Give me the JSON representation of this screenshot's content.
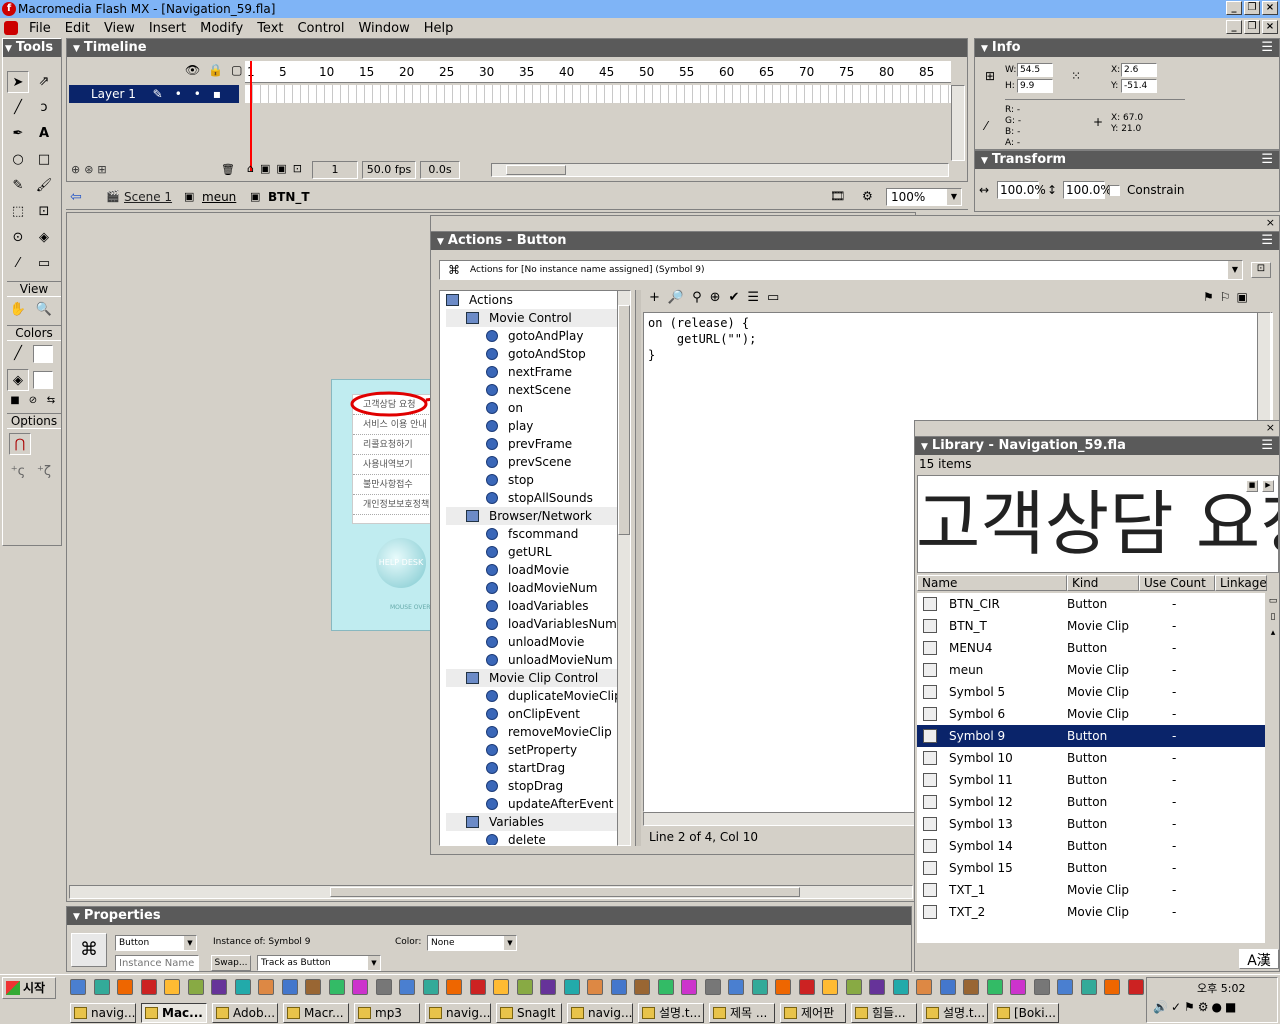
{
  "window": {
    "title": "Macromedia Flash MX - [Navigation_59.fla]",
    "app_icon": "flash-icon"
  },
  "menu": [
    "File",
    "Edit",
    "View",
    "Insert",
    "Modify",
    "Text",
    "Control",
    "Window",
    "Help"
  ],
  "tools": {
    "title": "Tools",
    "view_label": "View",
    "colors_label": "Colors",
    "options_label": "Options"
  },
  "timeline": {
    "title": "Timeline",
    "layer_name": "Layer 1",
    "frame_numbers": [
      "1",
      "5",
      "10",
      "15",
      "20",
      "25",
      "30",
      "35",
      "40",
      "45",
      "50",
      "55",
      "60",
      "65",
      "70",
      "75",
      "80",
      "85"
    ],
    "current_frame": "1",
    "fps": "50.0 fps",
    "time": "0.0s"
  },
  "editbar": {
    "scene": "Scene 1",
    "crumb1": "meun",
    "crumb2": "BTN_T",
    "zoom": "100%"
  },
  "stage_menu": {
    "items": [
      "고객상담 요청",
      "서비스 이용 안내",
      "리콜요청하기",
      "사용내역보기",
      "불만사항접수",
      "개인정보보호정책"
    ],
    "help_desk": "HELP DESK",
    "mouse_over": "MOUSE OVER"
  },
  "info": {
    "title": "Info",
    "w": "54.5",
    "h": "9.9",
    "x": "2.6",
    "y": "-51.4",
    "r": "R: -",
    "g": "G: -",
    "b": "B: -",
    "a": "A: -",
    "cx": "X: 67.0",
    "cy": "Y: 21.0",
    "w_label": "W:",
    "h_label": "H:",
    "x_label": "X:",
    "y_label": "Y:"
  },
  "transform": {
    "title": "Transform",
    "w": "100.0%",
    "h": "100.0%",
    "constrain": "Constrain"
  },
  "actions": {
    "title": "Actions - Button",
    "target": "Actions for [No instance name assigned]  (Symbol 9)",
    "tree": [
      {
        "label": "Actions",
        "type": "book",
        "level": 0
      },
      {
        "label": "Movie Control",
        "type": "book",
        "level": 1
      },
      {
        "label": "gotoAndPlay",
        "type": "item",
        "level": 2
      },
      {
        "label": "gotoAndStop",
        "type": "item",
        "level": 2
      },
      {
        "label": "nextFrame",
        "type": "item",
        "level": 2
      },
      {
        "label": "nextScene",
        "type": "item",
        "level": 2
      },
      {
        "label": "on",
        "type": "item",
        "level": 2
      },
      {
        "label": "play",
        "type": "item",
        "level": 2
      },
      {
        "label": "prevFrame",
        "type": "item",
        "level": 2
      },
      {
        "label": "prevScene",
        "type": "item",
        "level": 2
      },
      {
        "label": "stop",
        "type": "item",
        "level": 2
      },
      {
        "label": "stopAllSounds",
        "type": "item",
        "level": 2
      },
      {
        "label": "Browser/Network",
        "type": "book",
        "level": 1
      },
      {
        "label": "fscommand",
        "type": "item",
        "level": 2
      },
      {
        "label": "getURL",
        "type": "item",
        "level": 2
      },
      {
        "label": "loadMovie",
        "type": "item",
        "level": 2
      },
      {
        "label": "loadMovieNum",
        "type": "item",
        "level": 2
      },
      {
        "label": "loadVariables",
        "type": "item",
        "level": 2
      },
      {
        "label": "loadVariablesNum",
        "type": "item",
        "level": 2
      },
      {
        "label": "unloadMovie",
        "type": "item",
        "level": 2
      },
      {
        "label": "unloadMovieNum",
        "type": "item",
        "level": 2
      },
      {
        "label": "Movie Clip Control",
        "type": "book",
        "level": 1
      },
      {
        "label": "duplicateMovieClip",
        "type": "item",
        "level": 2
      },
      {
        "label": "onClipEvent",
        "type": "item",
        "level": 2
      },
      {
        "label": "removeMovieClip",
        "type": "item",
        "level": 2
      },
      {
        "label": "setProperty",
        "type": "item",
        "level": 2
      },
      {
        "label": "startDrag",
        "type": "item",
        "level": 2
      },
      {
        "label": "stopDrag",
        "type": "item",
        "level": 2
      },
      {
        "label": "updateAfterEvent",
        "type": "item",
        "level": 2
      },
      {
        "label": "Variables",
        "type": "book",
        "level": 1
      },
      {
        "label": "delete",
        "type": "item",
        "level": 2
      }
    ],
    "code": [
      "on (release) {",
      "    getURL(\"\");",
      "}"
    ],
    "status": "Line 2 of 4, Col 10"
  },
  "library": {
    "title": "Library - Navigation_59.fla",
    "count": "15 items",
    "preview_text": "고객상담 요청",
    "columns": [
      "Name",
      "Kind",
      "Use Count",
      "Linkage"
    ],
    "rows": [
      {
        "name": "BTN_CIR",
        "kind": "Button",
        "use": "-",
        "icon": "button-symbol-icon"
      },
      {
        "name": "BTN_T",
        "kind": "Movie Clip",
        "use": "-",
        "icon": "movieclip-symbol-icon"
      },
      {
        "name": "MENU4",
        "kind": "Button",
        "use": "-",
        "icon": "button-symbol-icon"
      },
      {
        "name": "meun",
        "kind": "Movie Clip",
        "use": "-",
        "icon": "movieclip-symbol-icon"
      },
      {
        "name": "Symbol 5",
        "kind": "Movie Clip",
        "use": "-",
        "icon": "movieclip-symbol-icon"
      },
      {
        "name": "Symbol 6",
        "kind": "Movie Clip",
        "use": "-",
        "icon": "movieclip-symbol-icon"
      },
      {
        "name": "Symbol 9",
        "kind": "Button",
        "use": "-",
        "icon": "button-symbol-icon",
        "selected": true
      },
      {
        "name": "Symbol 10",
        "kind": "Button",
        "use": "-",
        "icon": "button-symbol-icon"
      },
      {
        "name": "Symbol 11",
        "kind": "Button",
        "use": "-",
        "icon": "button-symbol-icon"
      },
      {
        "name": "Symbol 12",
        "kind": "Button",
        "use": "-",
        "icon": "button-symbol-icon"
      },
      {
        "name": "Symbol 13",
        "kind": "Button",
        "use": "-",
        "icon": "button-symbol-icon"
      },
      {
        "name": "Symbol 14",
        "kind": "Button",
        "use": "-",
        "icon": "button-symbol-icon"
      },
      {
        "name": "Symbol 15",
        "kind": "Button",
        "use": "-",
        "icon": "button-symbol-icon"
      },
      {
        "name": "TXT_1",
        "kind": "Movie Clip",
        "use": "-",
        "icon": "movieclip-symbol-icon"
      },
      {
        "name": "TXT_2",
        "kind": "Movie Clip",
        "use": "-",
        "icon": "movieclip-symbol-icon"
      }
    ],
    "ime": "A漢"
  },
  "properties": {
    "title": "Properties",
    "type": "Button",
    "instance_placeholder": "Instance Name",
    "instance_of": "Instance of:  Symbol 9",
    "swap": "Swap...",
    "track": "Track as Button",
    "color_label": "Color:",
    "color_value": "None"
  },
  "taskbar": {
    "start": "시작",
    "clock": "오후 5:02",
    "buttons": [
      {
        "label": "navig...",
        "active": false
      },
      {
        "label": "Mac...",
        "active": true
      },
      {
        "label": "Adob...",
        "active": false
      },
      {
        "label": "Macr...",
        "active": false
      },
      {
        "label": "mp3",
        "active": false
      },
      {
        "label": "navig...",
        "active": false
      },
      {
        "label": "SnagIt",
        "active": false
      },
      {
        "label": "navig...",
        "active": false
      },
      {
        "label": "설명.t...",
        "active": false
      },
      {
        "label": "제목 ...",
        "active": false
      },
      {
        "label": "제어판",
        "active": false
      },
      {
        "label": "힘들...",
        "active": false
      },
      {
        "label": "설명.t...",
        "active": false
      },
      {
        "label": "[Boki...",
        "active": false
      }
    ]
  },
  "colors": {
    "accent": "#0a246a",
    "panel_header": "#5a5a5a",
    "annotation": "#e00000",
    "stage_bg": "#c0ecf0"
  }
}
